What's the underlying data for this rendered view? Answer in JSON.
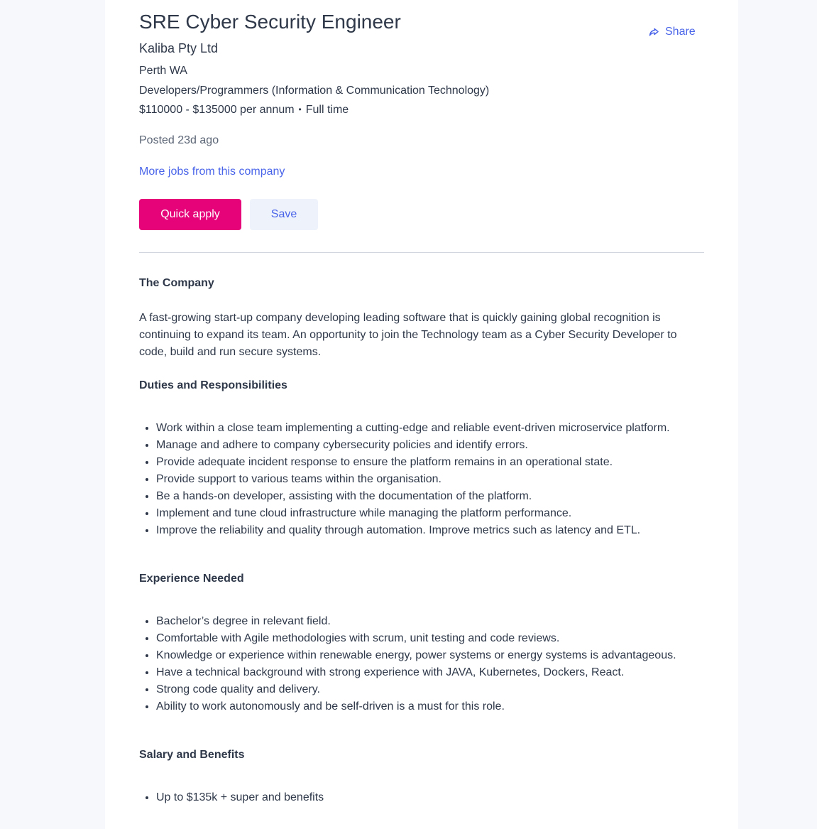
{
  "job": {
    "title": "SRE Cyber Security Engineer",
    "company": "Kaliba Pty Ltd",
    "location": "Perth WA",
    "category": "Developers/Programmers (Information & Communication Technology)",
    "salary": "$110000 - $135000 per annum",
    "separator": "•",
    "work_type": "Full time",
    "posted": "Posted 23d ago",
    "more_jobs_link": "More jobs from this company"
  },
  "actions": {
    "share_label": "Share",
    "share_icon": "share-arrow-icon",
    "quick_apply_label": "Quick apply",
    "save_label": "Save"
  },
  "colors": {
    "accent_link": "#4964e9",
    "apply_button": "#e60278",
    "save_button_bg": "#eef2fb",
    "text": "#2e3849",
    "page_bg": "#f7f8fb"
  },
  "description": {
    "company_heading": "The Company",
    "company_text": "A fast-growing start-up company developing leading software that is quickly gaining global recognition is continuing to expand its team. An opportunity to join the Technology team as a Cyber Security Developer to code, build and run secure systems.",
    "duties_heading": "Duties and Responsibilities",
    "duties": [
      "Work within a close team implementing a cutting-edge and reliable event-driven microservice platform.",
      "Manage and adhere to company cybersecurity policies and identify errors.",
      "Provide adequate incident response to ensure the platform remains in an operational state.",
      "Provide support to various teams within the organisation.",
      "Be a hands-on developer, assisting with the documentation of the platform.",
      "Implement and tune cloud infrastructure while managing the platform performance.",
      "Improve the reliability and quality through automation. Improve metrics such as latency and ETL."
    ],
    "experience_heading": "Experience Needed",
    "experience": [
      "Bachelor’s degree in relevant field.",
      "Comfortable with Agile methodologies with scrum, unit testing and code reviews.",
      "Knowledge or experience within renewable energy, power systems or energy systems is advantageous.",
      "Have a technical background with strong experience with JAVA, Kubernetes, Dockers, React.",
      "Strong code quality and delivery.",
      "Ability to work autonomously and be self-driven is a must for this role."
    ],
    "salary_heading": "Salary and Benefits",
    "benefits": [
      "Up to $135k + super and benefits"
    ]
  }
}
